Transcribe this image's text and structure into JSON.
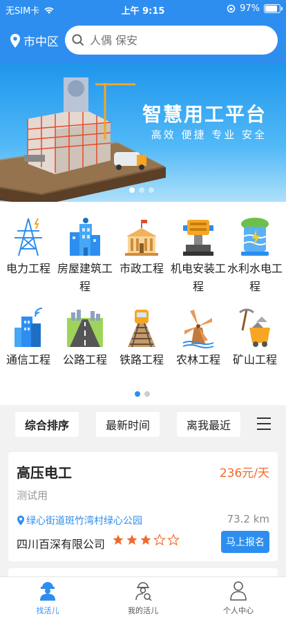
{
  "status_bar": {
    "carrier": "无SIM卡",
    "time": "上午 9:15",
    "battery": "97%",
    "battery_level": 0.97
  },
  "header": {
    "location": "市中区",
    "search_placeholder": "人偶 保安"
  },
  "banner": {
    "title": "智慧用工平台",
    "subtitle": "高效 便捷 专业 安全",
    "page_count": 3,
    "active_page": 1
  },
  "categories": [
    {
      "label": "电力工程",
      "icon": "power-tower-icon"
    },
    {
      "label": "房屋建筑工程",
      "icon": "building-icon"
    },
    {
      "label": "市政工程",
      "icon": "government-hall-icon"
    },
    {
      "label": "机电安装工程",
      "icon": "machinery-icon"
    },
    {
      "label": "水利水电工程",
      "icon": "water-power-icon"
    },
    {
      "label": "通信工程",
      "icon": "signal-tower-icon"
    },
    {
      "label": "公路工程",
      "icon": "highway-icon"
    },
    {
      "label": "铁路工程",
      "icon": "railway-icon"
    },
    {
      "label": "农林工程",
      "icon": "windmill-icon"
    },
    {
      "label": "矿山工程",
      "icon": "mining-cart-icon"
    }
  ],
  "category_pages": {
    "count": 2,
    "active": 1
  },
  "sort": {
    "options": [
      "综合排序",
      "最新时间",
      "离我最近"
    ],
    "active": "综合排序"
  },
  "job": {
    "title": "高压电工",
    "price": "236元/天",
    "description": "测试用",
    "address": "绿心街道斑竹湾村绿心公园",
    "distance": "73.2 km",
    "company": "四川百深有限公司",
    "rating": 3,
    "rating_max": 5,
    "apply_label": "马上报名"
  },
  "tabs": [
    {
      "label": "找活儿",
      "icon": "worker-icon"
    },
    {
      "label": "我的活儿",
      "icon": "my-jobs-icon"
    },
    {
      "label": "个人中心",
      "icon": "user-icon"
    }
  ],
  "colors": {
    "primary": "#2d8ef0",
    "price": "#f06a2b",
    "star": "#f06a2b"
  }
}
